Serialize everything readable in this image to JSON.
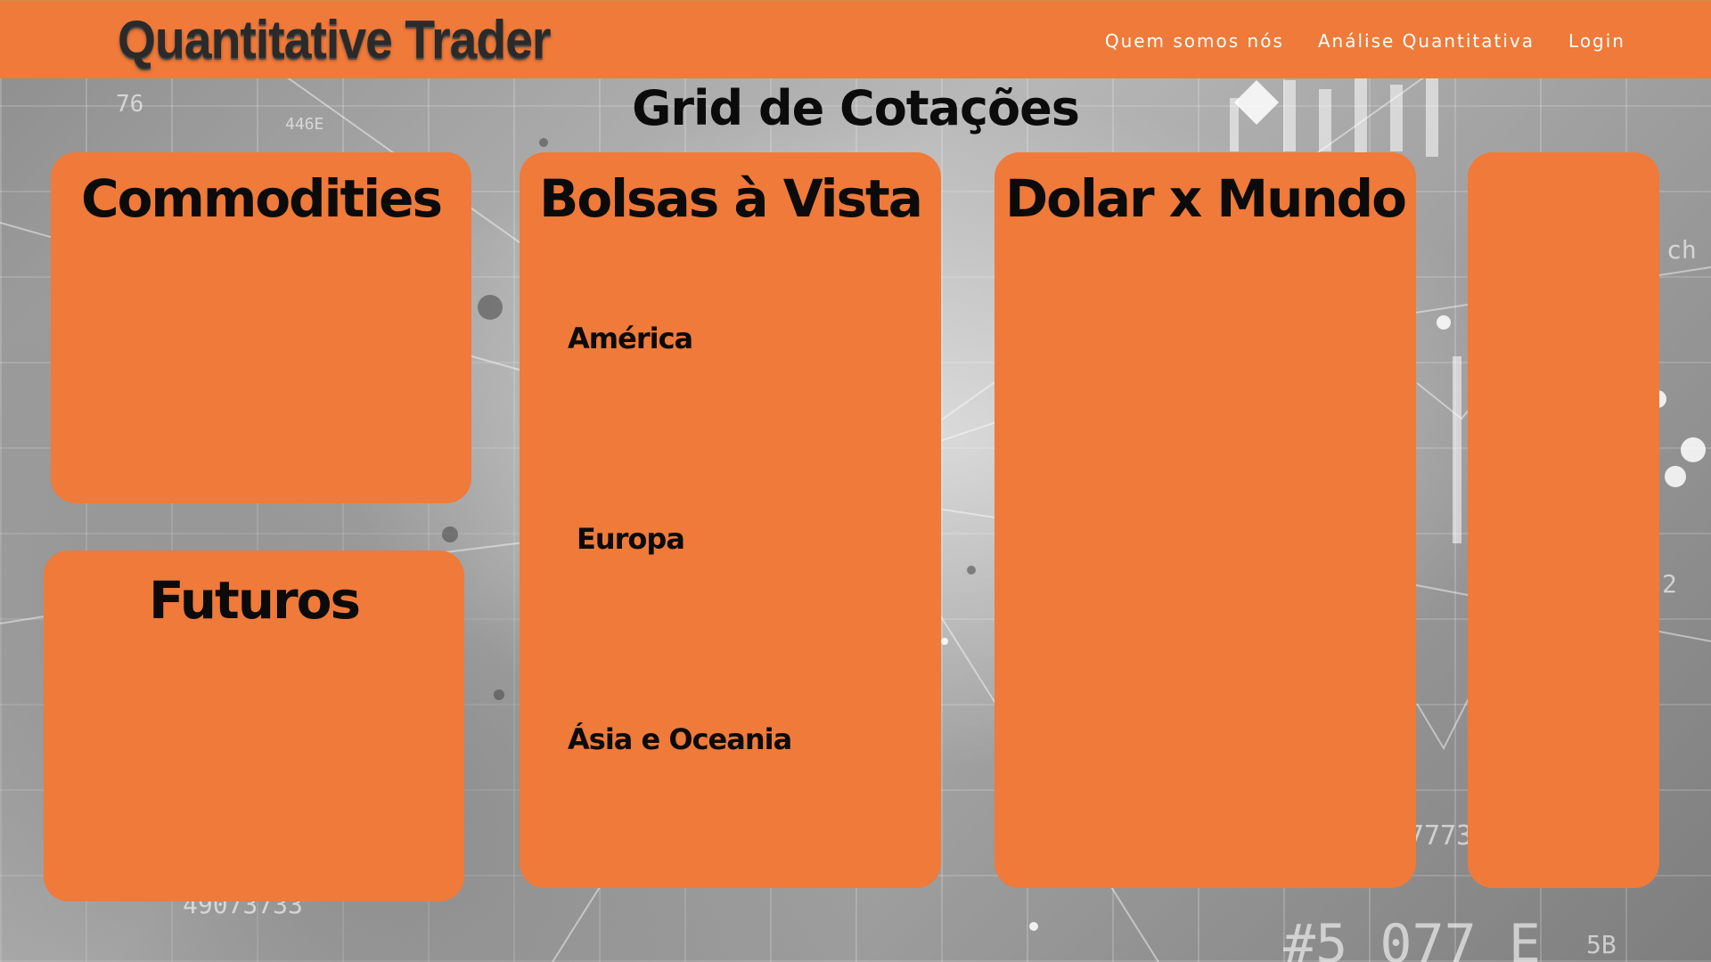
{
  "header": {
    "logo_text": "Quantitative Trader",
    "nav": [
      {
        "label": "Quem somos nós"
      },
      {
        "label": "Análise Quantitativa"
      },
      {
        "label": "Login"
      }
    ]
  },
  "main": {
    "title": "Grid de Cotações",
    "cards": {
      "commodities": {
        "title": "Commodities"
      },
      "futuros": {
        "title": "Futuros"
      },
      "bolsas": {
        "title": "Bolsas à Vista",
        "sections": [
          "América",
          "Europa",
          "Ásia e Oceania"
        ]
      },
      "dolar": {
        "title": "Dolar x Mundo"
      },
      "extra": {
        "title": ""
      }
    }
  },
  "colors": {
    "accent": "#ef7a3a",
    "text": "#0b0b0b",
    "nav_text": "#ffffff"
  }
}
